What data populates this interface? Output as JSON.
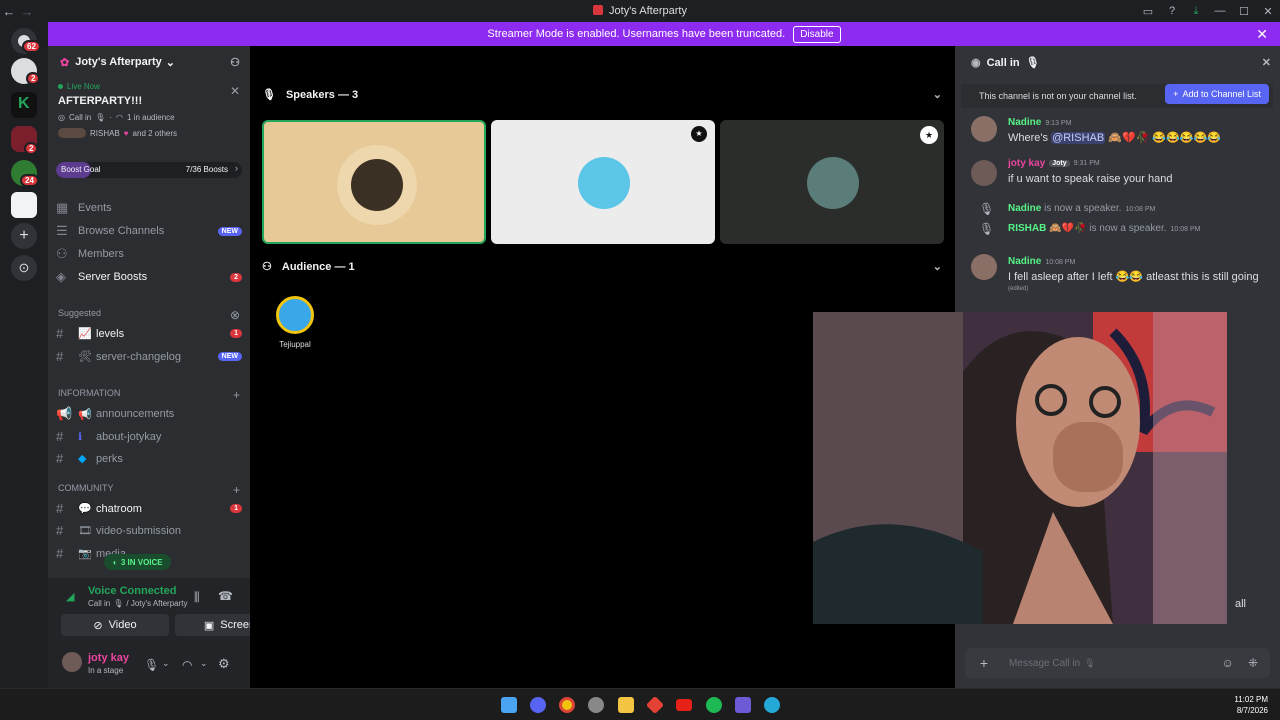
{
  "window": {
    "title": "Joty's Afterparty"
  },
  "banner": {
    "text": "Streamer Mode is enabled. Usernames have been truncated.",
    "disable_label": "Disable"
  },
  "rail": {
    "badges": [
      "62",
      "2",
      "2",
      "24"
    ]
  },
  "server": {
    "name": "Joty's Afterparty",
    "live_label": "Live Now",
    "stage_title": "AFTERPARTY!!!",
    "call_in": "Call in",
    "audience_count": "1 in audience",
    "participants": "RISHAB",
    "and_others": "and 2 others",
    "boost_goal_label": "Boost Goal",
    "boost_progress": "7/36 Boosts",
    "boost_fraction": 0.19
  },
  "nav": {
    "events": "Events",
    "browse": "Browse Channels",
    "browse_badge": "NEW",
    "members": "Members",
    "boosts": "Server Boosts",
    "boosts_badge": "2"
  },
  "suggested": {
    "label": "Suggested",
    "channels": [
      {
        "name": "levels",
        "badge": "1"
      },
      {
        "name": "server-changelog",
        "badge": "NEW"
      }
    ]
  },
  "categories": {
    "information": {
      "label": "INFORMATION",
      "channels": [
        "announcements",
        "about-jotykay",
        "perks"
      ]
    },
    "community": {
      "label": "COMMUNITY",
      "channels": [
        "chatroom",
        "video-submission",
        "media"
      ],
      "chatroom_badge": "1",
      "in_voice": "3 IN VOICE"
    }
  },
  "voice": {
    "status": "Voice Connected",
    "location": "Call in",
    "server": "/ Joty's Afterparty",
    "video_label": "Video",
    "screen_label": "Screen"
  },
  "user": {
    "name": "joty kay",
    "status": "In a stage"
  },
  "stage": {
    "speakers_header": "Speakers — 3",
    "audience_header": "Audience — 1",
    "audience": [
      {
        "name": "Tejiuppal"
      }
    ]
  },
  "chat": {
    "channel": "Call in",
    "notice": "This channel is not on your channel list.",
    "add_button": "Add to Channel List",
    "messages": [
      {
        "author": "Nadine",
        "time": "9:13 PM",
        "text_pre": "Where's",
        "mention": "@RISHAB"
      },
      {
        "author": "joty kay",
        "tag": "Joty",
        "time": "9:31 PM",
        "text": "if u want to speak raise your hand"
      },
      {
        "author": "Nadine",
        "system": "is now a speaker.",
        "time": "10:08 PM"
      },
      {
        "author": "RISHAB",
        "system": "is now a speaker.",
        "time": "10:08 PM"
      },
      {
        "author": "Nadine",
        "time": "10:08 PM",
        "text_pre": "I fell asleep after I left",
        "text_post": "atleast this is still going",
        "edited": "(edited)"
      }
    ],
    "partial_word": "all",
    "placeholder": "Message Call in"
  },
  "clock": {
    "time": "11:02 PM",
    "date": "8/7/2026"
  },
  "colors": {
    "accent": "#5865f2",
    "banner": "#8e2bf0",
    "green": "#57f287",
    "pink": "#eb459f",
    "red": "#da373c"
  }
}
